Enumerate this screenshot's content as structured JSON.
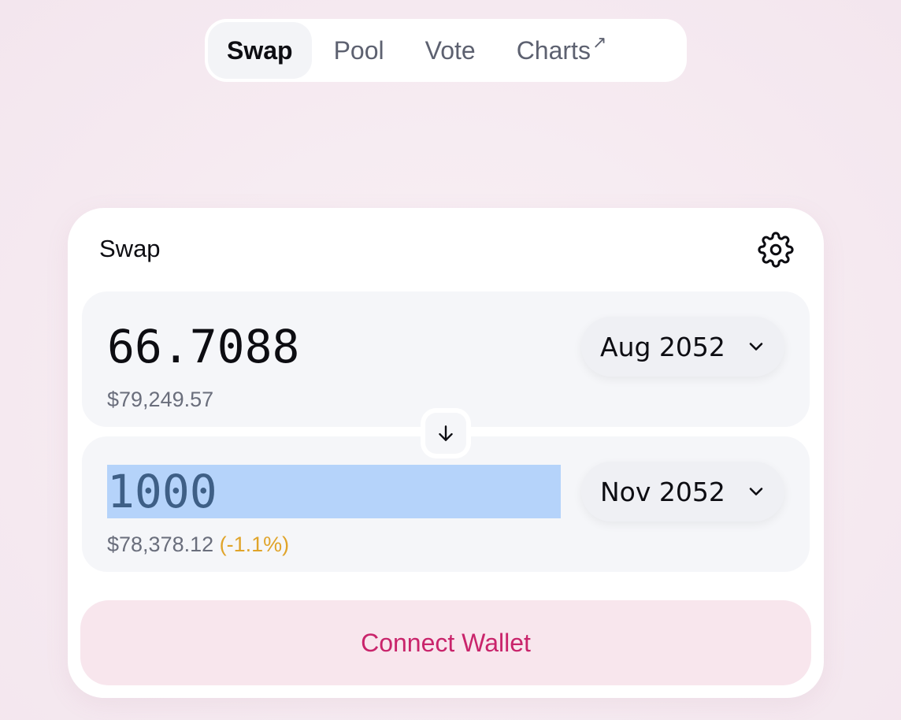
{
  "nav": {
    "tabs": [
      {
        "label": "Swap",
        "active": true
      },
      {
        "label": "Pool",
        "active": false
      },
      {
        "label": "Vote",
        "active": false
      },
      {
        "label": "Charts",
        "active": false,
        "external": true,
        "external_glyph": "↗"
      }
    ]
  },
  "swap": {
    "title": "Swap",
    "settings_icon": "gear-icon",
    "input": {
      "amount": "66.7088",
      "usd_value": "$79,249.57",
      "token": "Aug 2052"
    },
    "switch_icon": "arrow-down-icon",
    "output": {
      "amount": "1000",
      "usd_value": "$78,378.12",
      "price_impact": "(-1.1%)",
      "token": "Nov 2052"
    },
    "connect_label": "Connect Wallet"
  },
  "colors": {
    "accent": "#c9246b",
    "accent_bg": "#f8e6ed",
    "warning": "#e0a42a",
    "selection": "#b5d3fa"
  }
}
